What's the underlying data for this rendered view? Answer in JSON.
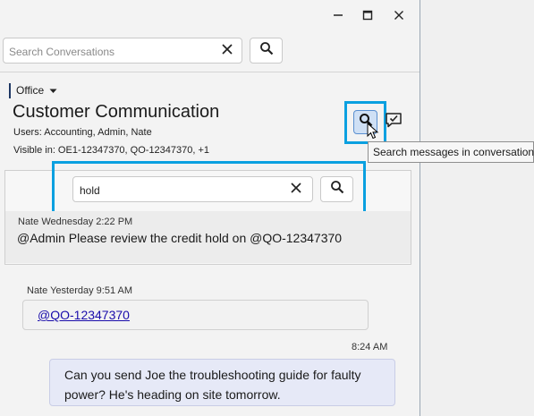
{
  "window": {
    "controls": {
      "minimize": "minimize-icon",
      "maximize": "maximize-icon",
      "close": "close-icon"
    }
  },
  "top_search": {
    "placeholder": "Search Conversations",
    "value": ""
  },
  "conversation": {
    "folder": "Office",
    "title": "Customer Communication",
    "users": "Users: Accounting, Admin, Nate",
    "visible_in": "Visible in: OE1-12347370, QO-12347370, +1"
  },
  "toolbar": {
    "tooltip": "Search messages in conversation"
  },
  "message_search": {
    "value": "hold"
  },
  "search_result": {
    "author": "Nate",
    "time": "Wednesday 2:22 PM",
    "text": "@Admin Please review the credit hold on @QO-12347370"
  },
  "messages": [
    {
      "author": "Nate",
      "time": "Yesterday 9:51 AM",
      "link": "@QO-12347370"
    },
    {
      "time": "8:24 AM",
      "text": "Can you send Joe the troubleshooting guide for faulty power? He's heading on site tomorrow."
    }
  ],
  "colors": {
    "highlight": "#0aa0e0",
    "accent": "#1f3864",
    "link": "#1a0dab"
  }
}
